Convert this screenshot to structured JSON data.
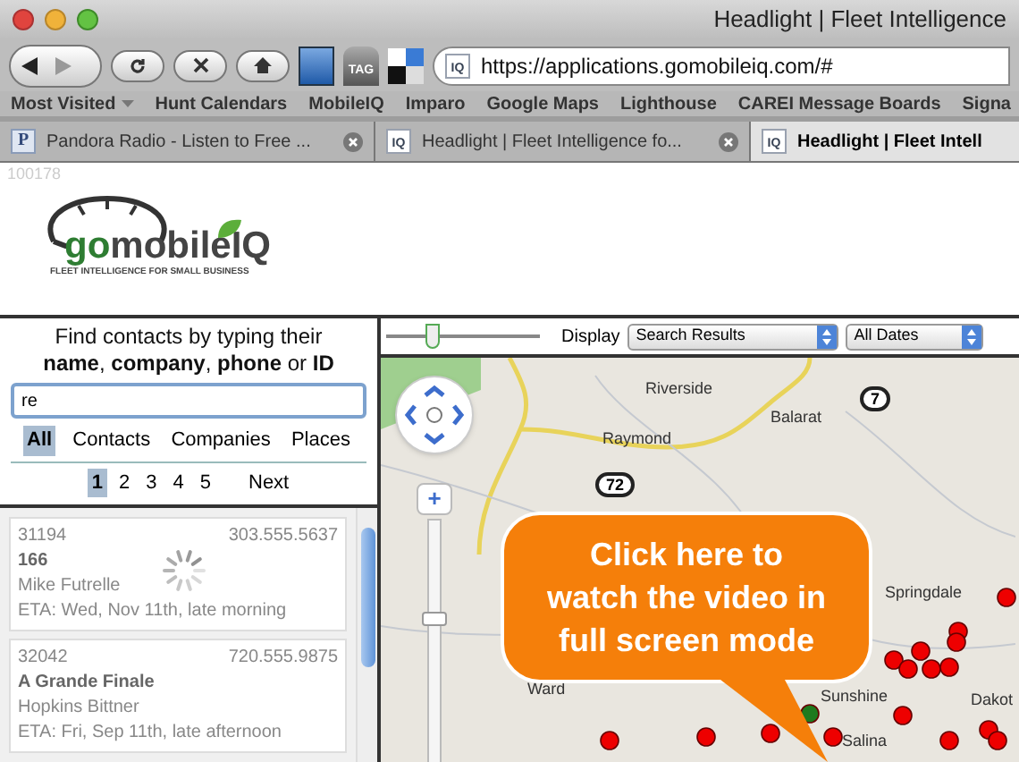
{
  "window": {
    "title": "Headlight | Fleet Intelligence"
  },
  "toolbar": {
    "url": "https://applications.gomobileiq.com/#",
    "url_favicon": "IQ",
    "tag_label": "TAG"
  },
  "bookmarks": [
    {
      "label": "Most Visited",
      "menu": true
    },
    {
      "label": "Hunt Calendars",
      "menu": false
    },
    {
      "label": "MobileIQ",
      "menu": false
    },
    {
      "label": "Imparo",
      "menu": false
    },
    {
      "label": "Google Maps",
      "menu": false
    },
    {
      "label": "Lighthouse",
      "menu": false
    },
    {
      "label": "CAREI Message Boards",
      "menu": false
    },
    {
      "label": "Signa",
      "menu": false
    }
  ],
  "tabs": [
    {
      "label": "Pandora Radio - Listen to Free ...",
      "favicon": "P",
      "kind": "pandora",
      "selected": false
    },
    {
      "label": "Headlight | Fleet Intelligence fo...",
      "favicon": "IQ",
      "kind": "iq",
      "selected": false
    },
    {
      "label": "Headlight | Fleet Intell",
      "favicon": "IQ",
      "kind": "iq",
      "selected": true
    }
  ],
  "page_id": "100178",
  "logo": {
    "name_dark": "go",
    "name_light": "mobileIQ",
    "tagline": "FLEET INTELLIGENCE FOR SMALL BUSINESS"
  },
  "search": {
    "hint": "Find contacts by typing their **name**, **company**, **phone** or **ID**",
    "value": "re",
    "filters": [
      {
        "label": "All",
        "selected": true
      },
      {
        "label": "Contacts",
        "selected": false
      },
      {
        "label": "Companies",
        "selected": false
      },
      {
        "label": "Places",
        "selected": false
      }
    ],
    "pages": [
      {
        "label": "1",
        "selected": true
      },
      {
        "label": "2",
        "selected": false
      },
      {
        "label": "3",
        "selected": false
      },
      {
        "label": "4",
        "selected": false
      },
      {
        "label": "5",
        "selected": false
      }
    ],
    "next": "Next"
  },
  "results": [
    {
      "id": "31194",
      "phone": "303.555.5637",
      "name": "166",
      "contact": "Mike Futrelle",
      "eta": "ETA: Wed, Nov 11th, late morning",
      "loading": true
    },
    {
      "id": "32042",
      "phone": "720.555.9875",
      "name": "A Grande Finale",
      "contact": "Hopkins Bittner",
      "eta": "ETA: Fri, Sep 11th, late afternoon",
      "loading": false
    }
  ],
  "map_controls": {
    "time_slider": {
      "level": 0.3
    },
    "display_label": "Display",
    "display_value": "Search Results",
    "dates_value": "All Dates"
  },
  "map": {
    "labels": [
      {
        "text": "Riverside",
        "kind": "town"
      },
      {
        "text": "Balarat",
        "kind": "town"
      },
      {
        "text": "7",
        "kind": "route"
      },
      {
        "text": "Raymond",
        "kind": "town"
      },
      {
        "text": "72",
        "kind": "route"
      },
      {
        "text": "Springdale",
        "kind": "town"
      },
      {
        "text": "Ward",
        "kind": "town"
      },
      {
        "text": "Sunshine",
        "kind": "town"
      },
      {
        "text": "Salina",
        "kind": "town"
      },
      {
        "text": "Dakot",
        "kind": "town"
      }
    ],
    "zoom": {
      "plus": "+",
      "level": 0.6
    },
    "callout": "Click here to watch the video in full screen mode"
  }
}
